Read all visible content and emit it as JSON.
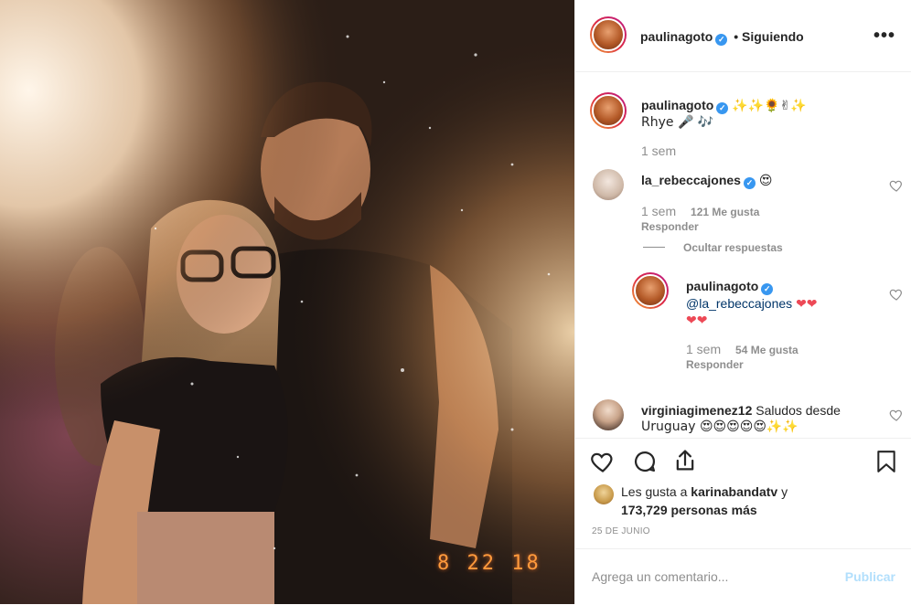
{
  "photo": {
    "alt_description": "",
    "date_stamp": "8 22 18"
  },
  "header": {
    "username": "paulinagoto",
    "separator": "•",
    "follow_status": "Siguiendo",
    "more_icon": "more-horizontal-icon"
  },
  "caption": {
    "username": "paulinagoto",
    "emojis": "✨✨🌻✌✨",
    "text": "Rhye 🎤 🎶",
    "time": "1 sem"
  },
  "comments": [
    {
      "username": "la_rebeccajones",
      "text": "😍",
      "time": "1 sem",
      "likes": "121 Me gusta",
      "reply": "Responder",
      "hide_replies": "Ocultar respuestas"
    },
    {
      "username": "paulinagoto",
      "mention": "@la_rebeccajones",
      "text": "❤❤",
      "text2": "❤❤",
      "time": "1 sem",
      "likes": "54 Me gusta",
      "reply": "Responder"
    },
    {
      "username": "virginiagimenez12",
      "text": "Saludos desde",
      "text2": "Uruguay 😍😍😍😍😍✨✨"
    }
  ],
  "likes": {
    "prefix": "Les gusta a",
    "user": "karinabandatv",
    "suffix": "y",
    "others": "173,729 personas más"
  },
  "date": "25 DE JUNIO",
  "composer": {
    "placeholder": "Agrega un comentario...",
    "post_label": "Publicar"
  },
  "colors": {
    "accent": "#3897f0",
    "heart_red": "#ed4956",
    "post_disabled": "#b2dffc",
    "muted": "#8e8e8e"
  }
}
